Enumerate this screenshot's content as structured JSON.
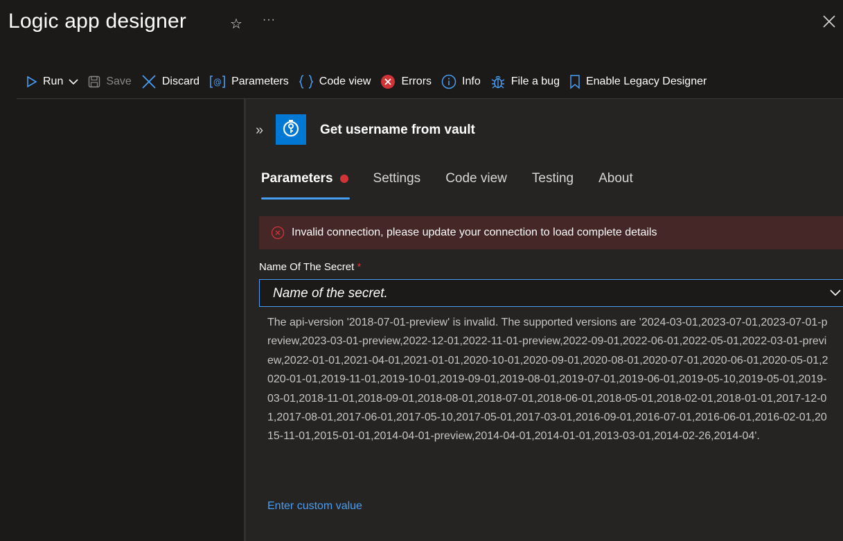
{
  "header": {
    "title": "Logic app designer",
    "star_icon": "☆",
    "more_icon": "···"
  },
  "toolbar": {
    "run_label": "Run",
    "save_label": "Save",
    "discard_label": "Discard",
    "parameters_label": "Parameters",
    "codeview_label": "Code view",
    "errors_label": "Errors",
    "info_label": "Info",
    "bug_label": "File a bug",
    "legacy_label": "Enable Legacy Designer"
  },
  "panel": {
    "collapse_icon": "»",
    "title": "Get username from vault",
    "tabs": [
      {
        "label": "Parameters",
        "has_error": true,
        "active": true
      },
      {
        "label": "Settings"
      },
      {
        "label": "Code view"
      },
      {
        "label": "Testing"
      },
      {
        "label": "About"
      }
    ],
    "error_banner": "Invalid connection, please update your connection to load complete details",
    "field_label": "Name Of The Secret",
    "required_marker": "*",
    "field_placeholder": "Name of the secret.",
    "field_error": "The api-version '2018-07-01-preview' is invalid. The supported versions are '2024-03-01,2023-07-01,2023-07-01-preview,2023-03-01-preview,2022-12-01,2022-11-01-preview,2022-09-01,2022-06-01,2022-05-01,2022-03-01-preview,2022-01-01,2021-04-01,2021-01-01,2020-10-01,2020-09-01,2020-08-01,2020-07-01,2020-06-01,2020-05-01,2020-01-01,2019-11-01,2019-10-01,2019-09-01,2019-08-01,2019-07-01,2019-06-01,2019-05-10,2019-05-01,2019-03-01,2018-11-01,2018-09-01,2018-08-01,2018-07-01,2018-06-01,2018-05-01,2018-02-01,2018-01-01,2017-12-01,2017-08-01,2017-06-01,2017-05-10,2017-05-01,2017-03-01,2016-09-01,2016-07-01,2016-06-01,2016-02-01,2015-11-01,2015-01-01,2014-04-01-preview,2014-04-01,2014-01-01,2013-03-01,2014-02-26,2014-04'.",
    "custom_value_link": "Enter custom value"
  },
  "colors": {
    "accent": "#479ef5",
    "error": "#d13438",
    "error_banner_bg": "#442726",
    "vault_icon_bg": "#0078d4"
  }
}
